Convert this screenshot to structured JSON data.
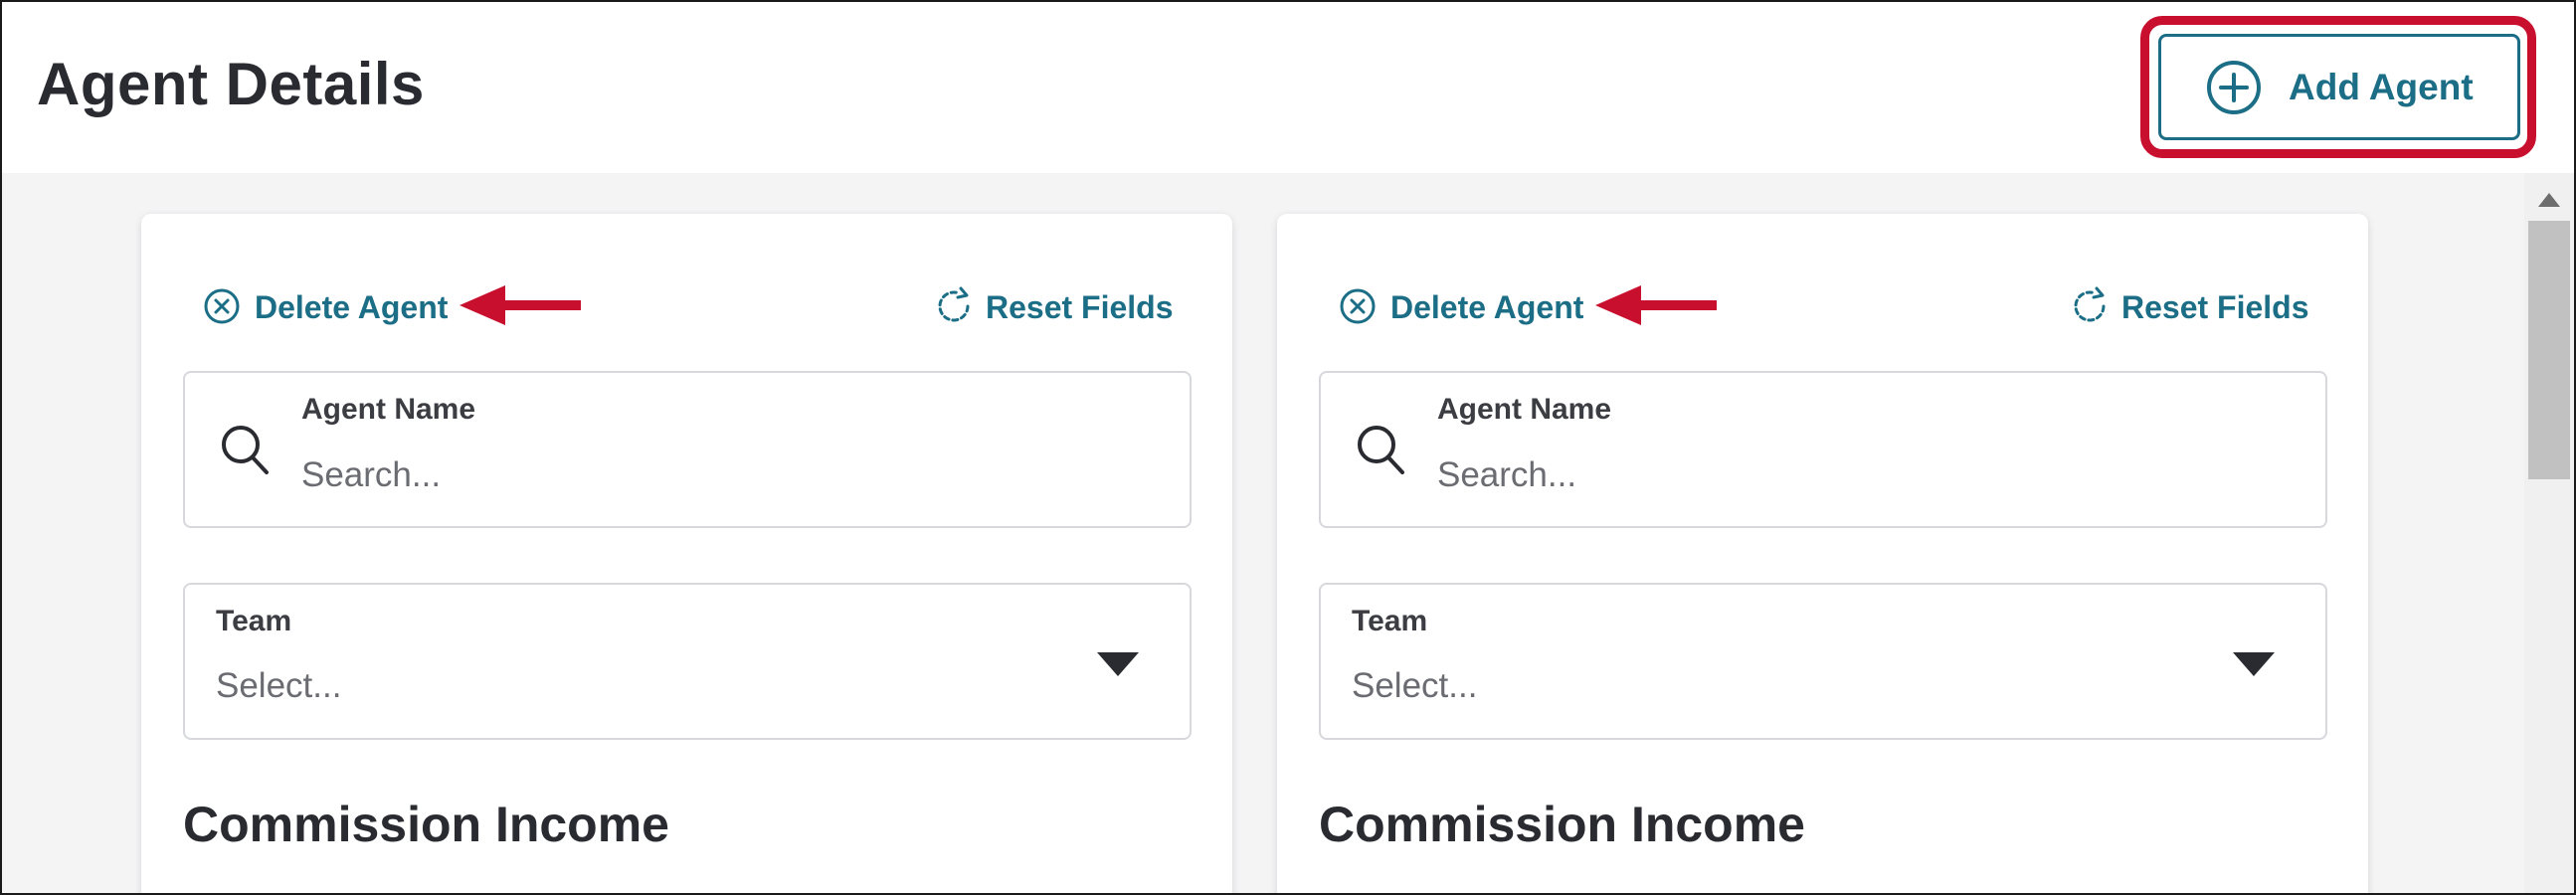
{
  "header": {
    "title": "Agent Details",
    "add_button_label": "Add Agent",
    "add_button_icon": "plus-circle-icon"
  },
  "colors": {
    "accent": "#1b6e86",
    "highlight": "#c8102e",
    "title_text": "#2a2b31",
    "background": "#f4f4f5"
  },
  "agents": [
    {
      "delete_label": "Delete Agent",
      "delete_icon": "x-circle-icon",
      "reset_label": "Reset Fields",
      "reset_icon": "refresh-icon",
      "name_field": {
        "label": "Agent Name",
        "placeholder": "Search...",
        "value": ""
      },
      "team_field": {
        "label": "Team",
        "value": "Select..."
      },
      "section_title": "Commission Income"
    },
    {
      "delete_label": "Delete Agent",
      "delete_icon": "x-circle-icon",
      "reset_label": "Reset Fields",
      "reset_icon": "refresh-icon",
      "name_field": {
        "label": "Agent Name",
        "placeholder": "Search...",
        "value": ""
      },
      "team_field": {
        "label": "Team",
        "value": "Select..."
      },
      "section_title": "Commission Income"
    }
  ]
}
